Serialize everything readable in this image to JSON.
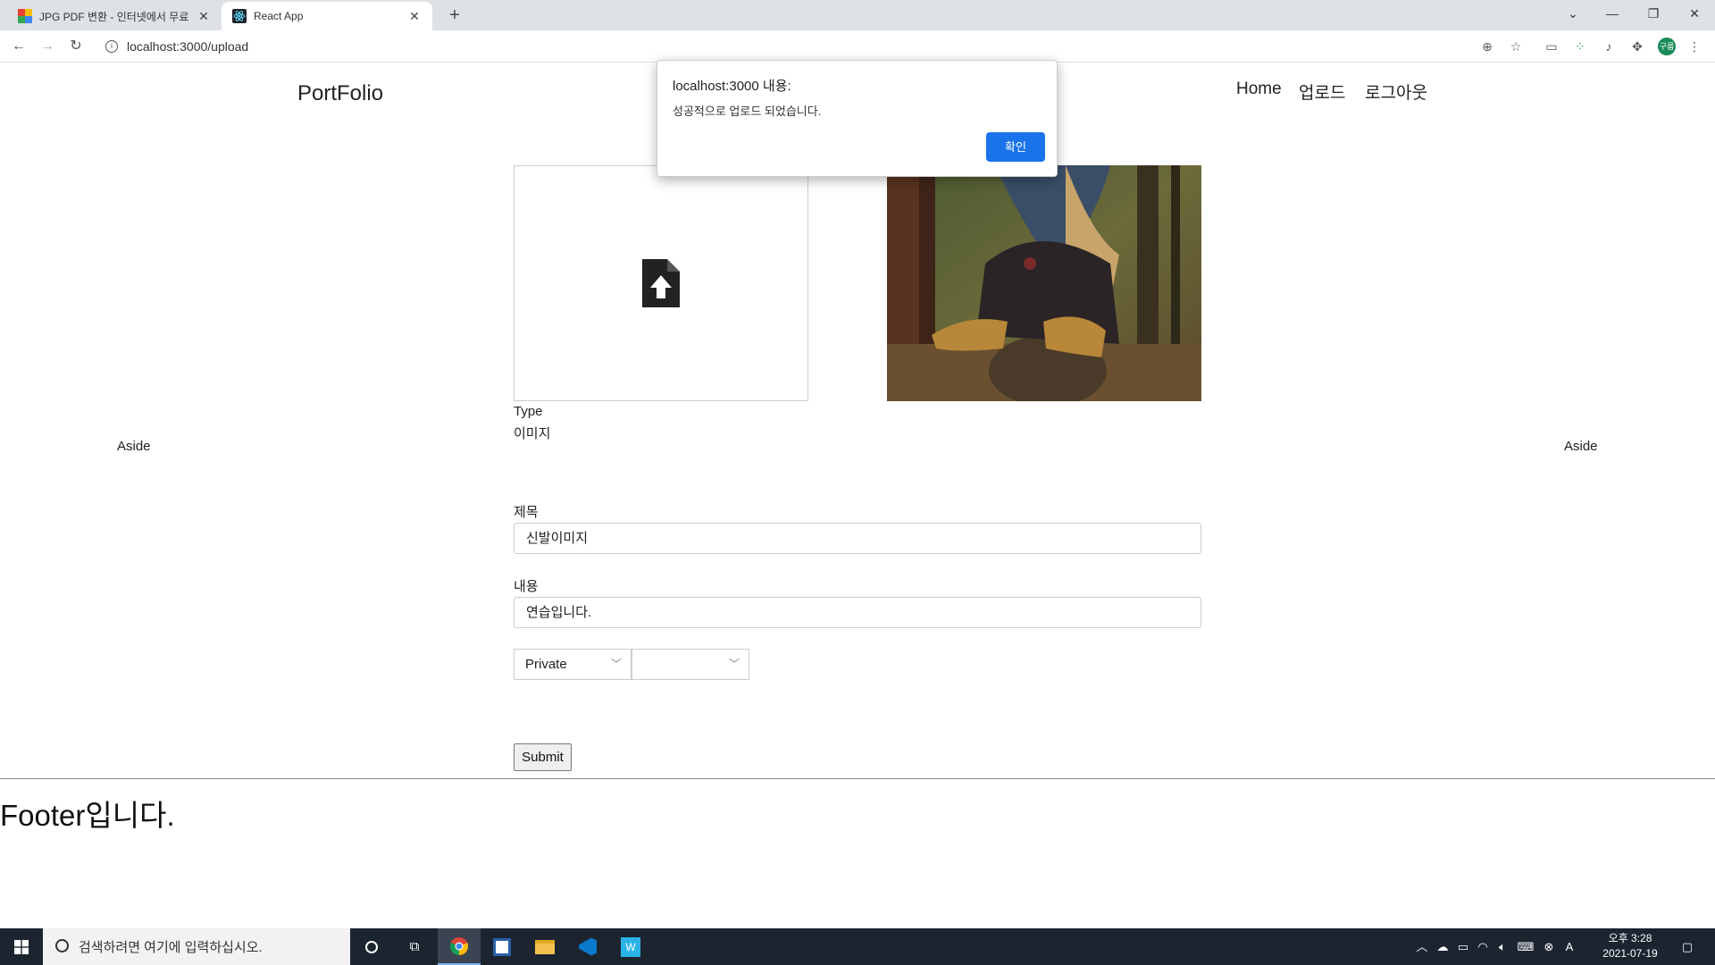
{
  "browser": {
    "tabs": [
      {
        "title": "JPG PDF 변환 - 인터넷에서 무료",
        "active": false
      },
      {
        "title": "React App",
        "active": true
      }
    ],
    "url": "localhost:3000/upload",
    "profile_initials": "구름"
  },
  "header": {
    "brand": "PortFolio",
    "nav": [
      "Home",
      "업로드",
      "로그아웃"
    ]
  },
  "aside": {
    "left": "Aside",
    "right": "Aside"
  },
  "form": {
    "type_label": "Type",
    "type_value": "이미지",
    "title_label": "제목",
    "title_value": "신발이미지",
    "content_label": "내용",
    "content_value": "연습입니다.",
    "privacy_select": "Private",
    "second_select": "",
    "submit": "Submit"
  },
  "footer": {
    "text": "Footer입니다."
  },
  "alert": {
    "title": "localhost:3000 내용:",
    "message": "성공적으로 업로드 되었습니다.",
    "ok": "확인"
  },
  "taskbar": {
    "search_placeholder": "검색하려면 여기에 입력하십시오.",
    "time": "오후 3:28",
    "date": "2021-07-19",
    "ime": "A"
  },
  "colors": {
    "accent": "#1a73e8",
    "taskbar": "#1c2430"
  }
}
